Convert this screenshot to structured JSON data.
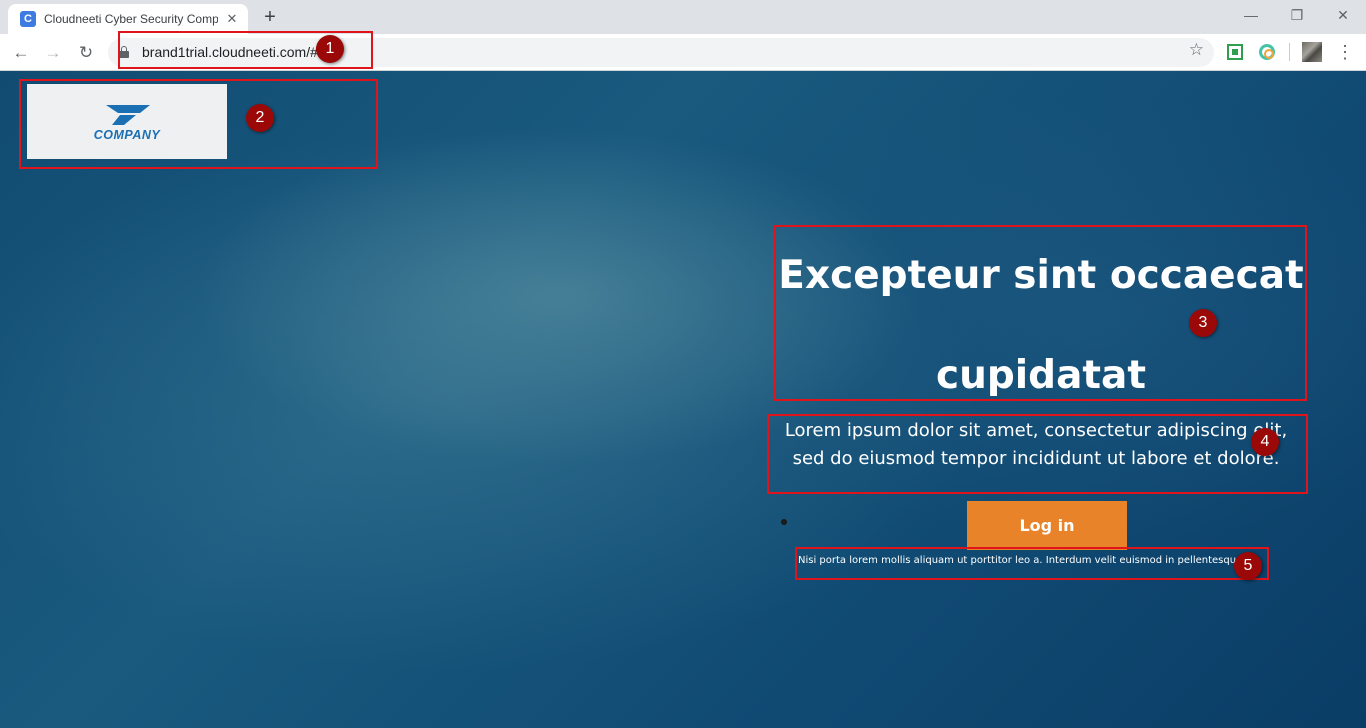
{
  "browser": {
    "tab_title": "Cloudneeti Cyber Security Comp",
    "tab_favicon_letter": "C",
    "new_tab": "+",
    "address": "brand1trial.cloudneeti.com/#"
  },
  "page": {
    "logo_text": "COMPANY",
    "headline_line1": "Excepteur sint occaecat",
    "headline_line2": "cupidatat",
    "subtitle_line1": "Lorem ipsum dolor sit amet, consectetur adipiscing elit,",
    "subtitle_line2": "sed do eiusmod tempor incididunt ut labore et dolore.",
    "login_label": "Log in",
    "footnote": "Nisi porta lorem mollis aliquam ut porttitor leo a. Interdum velit euismod in pellentesque"
  },
  "annotations": [
    "1",
    "2",
    "3",
    "4",
    "5"
  ],
  "colors": {
    "accent_orange": "#e8832a",
    "annotation_red": "#e0141b",
    "annotation_marker": "#9a0808",
    "logo_blue": "#1b6fb3"
  }
}
